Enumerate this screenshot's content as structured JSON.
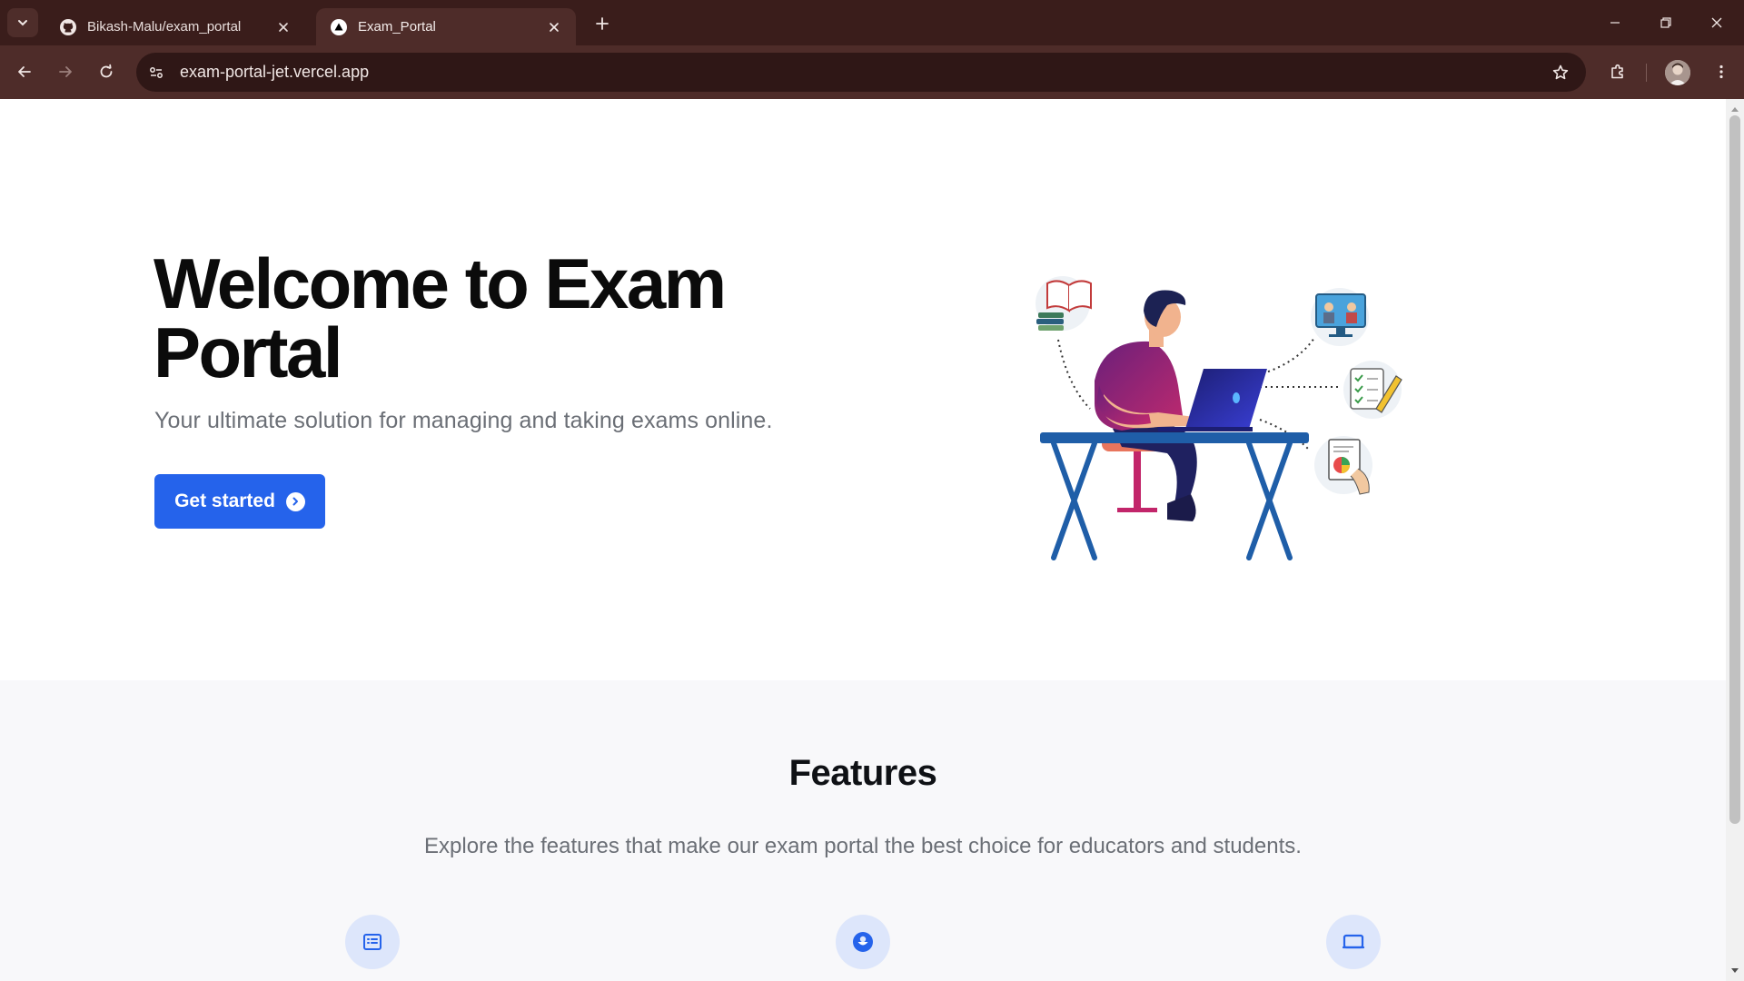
{
  "browser": {
    "tabs": [
      {
        "title": "Bikash-Malu/exam_portal",
        "icon": "github-icon",
        "active": false
      },
      {
        "title": "Exam_Portal",
        "icon": "vercel-icon",
        "active": true
      }
    ],
    "url": "exam-portal-jet.vercel.app"
  },
  "hero": {
    "title": "Welcome to Exam Portal",
    "subtitle": "Your ultimate solution for managing and taking exams online.",
    "cta_label": "Get started",
    "cta_icon": "arrow-circle-right-icon"
  },
  "features": {
    "title": "Features",
    "subtitle": "Explore the features that make our exam portal the best choice for educators and students.",
    "icons": [
      "list-icon",
      "user-circle-icon",
      "monitor-icon"
    ]
  },
  "colors": {
    "accent": "#2563eb",
    "chrome_dark": "#3a1d1b",
    "chrome_toolbar": "#4e2c29"
  }
}
